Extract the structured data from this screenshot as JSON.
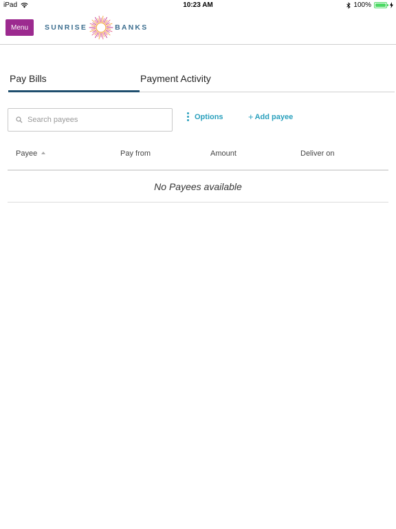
{
  "status_bar": {
    "device": "iPad",
    "time": "10:23 AM",
    "battery_text": "100%",
    "battery_level": 1.0,
    "icons": [
      "wifi-icon",
      "bluetooth-icon",
      "battery-icon",
      "charging-icon"
    ]
  },
  "header": {
    "menu_label": "Menu",
    "logo_left": "SUNRISE",
    "logo_right": "BANKS",
    "brand_color": "#9c2a8f",
    "logo_color": "#3c6e8f"
  },
  "tabs": [
    {
      "label": "Pay Bills",
      "active": true
    },
    {
      "label": "Payment Activity",
      "active": false
    }
  ],
  "toolbar": {
    "search_placeholder": "Search payees",
    "search_value": "",
    "options_label": "Options",
    "add_payee_label": "Add payee",
    "accent_color": "#2aa0bd"
  },
  "table": {
    "columns": [
      "Payee",
      "Pay from",
      "Amount",
      "Deliver on"
    ],
    "sorted_column": "Payee",
    "sort_direction": "ascending",
    "empty_message": "No Payees available"
  }
}
